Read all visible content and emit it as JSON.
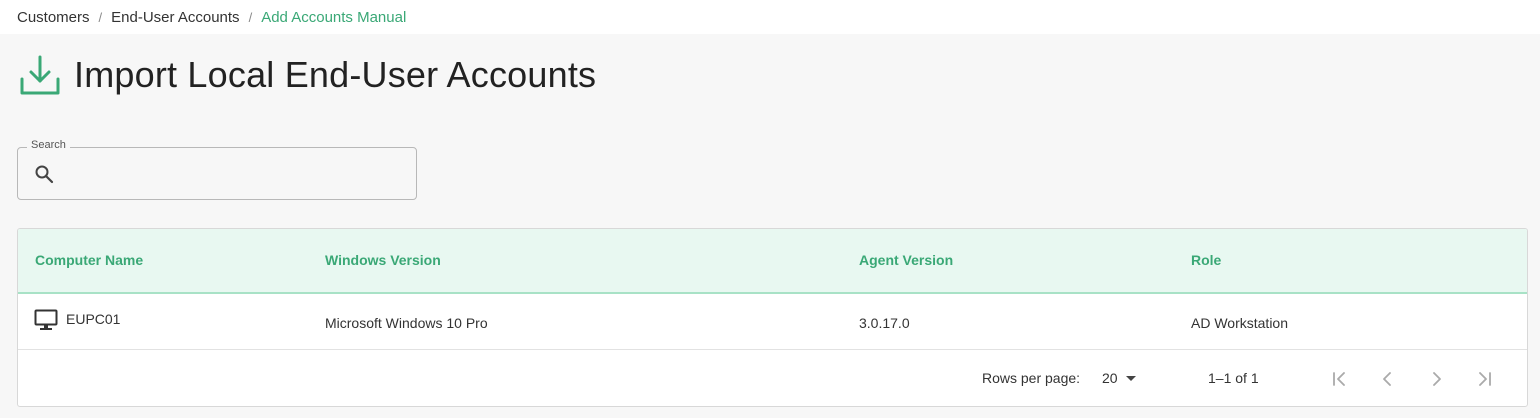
{
  "breadcrumb": {
    "items": [
      "Customers",
      "End-User Accounts"
    ],
    "separator": "/",
    "current": "Add Accounts Manual"
  },
  "page": {
    "title": "Import Local End-User Accounts",
    "title_icon": "download-icon"
  },
  "search": {
    "label": "Search",
    "value": "",
    "placeholder": "",
    "icon": "search-icon"
  },
  "table": {
    "columns": [
      "Computer Name",
      "Windows Version",
      "Agent Version",
      "Role"
    ],
    "rows": [
      {
        "icon": "desktop-computer-icon",
        "computer_name": "EUPC01",
        "windows_version": "Microsoft Windows 10 Pro",
        "agent_version": "3.0.17.0",
        "role": "AD Workstation"
      }
    ]
  },
  "pagination": {
    "rows_per_page_label": "Rows per page:",
    "rows_per_page": "20",
    "range": "1–1 of 1",
    "buttons": [
      "first-page-icon",
      "previous-page-icon",
      "next-page-icon",
      "last-page-icon"
    ]
  },
  "colors": {
    "accent": "#3aa876",
    "header_bg": "#e8f8f1",
    "page_bg": "#f7f7f7"
  }
}
